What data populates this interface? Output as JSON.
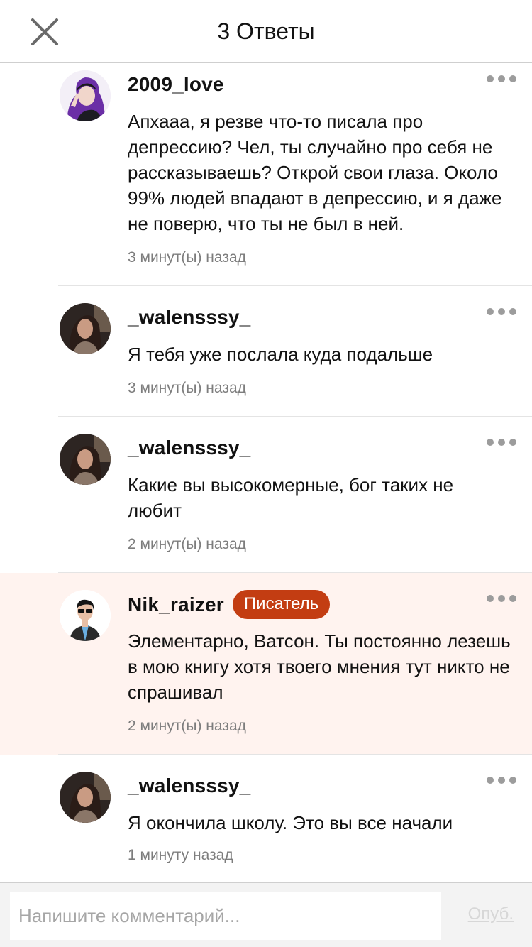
{
  "header": {
    "title": "3 Ответы"
  },
  "comments": [
    {
      "username": "2009_love",
      "text": "Апхааа, я резве что-то писала про депрессию? Чел, ты случайно про себя не рассказываешь? Открой свои глаза. Около 99% людей впадают в депрессию, и я даже не поверю, что ты не был в ней.",
      "time": "3 минут(ы) назад"
    },
    {
      "username": "_walensssy_",
      "text": "Я тебя уже послала куда подальше",
      "time": "3 минут(ы) назад"
    },
    {
      "username": "_walensssy_",
      "text": "Какие вы высокомерные, бог таких не любит",
      "time": "2 минут(ы) назад"
    },
    {
      "username": "Nik_raizer",
      "badge": "Писатель",
      "text": "Элементарно, Ватсон. Ты постоянно лезешь в мою книгу хотя твоего мнения тут никто не спрашивал",
      "time": "2 минут(ы) назад"
    },
    {
      "username": "_walensssy_",
      "text": "Я окончила школу. Это вы все начали",
      "time": "1 минуту назад"
    }
  ],
  "footer": {
    "placeholder": "Напишите комментарий...",
    "publish_label": "Опуб."
  },
  "colors": {
    "badge": "#c33d12",
    "highlight": "#fff3ef",
    "meta_text": "#7d7d7d"
  }
}
